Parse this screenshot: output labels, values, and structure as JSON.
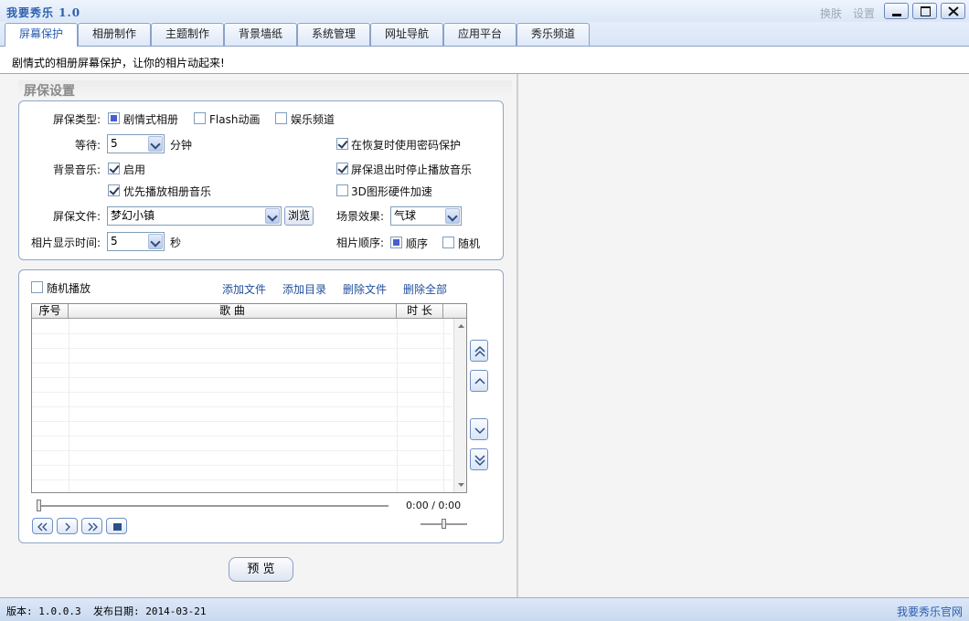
{
  "title_bar": {
    "app_title": "我要秀乐 1.0",
    "skin_link": "换肤",
    "settings_link": "设置"
  },
  "tabs": [
    {
      "label": "屏幕保护",
      "active": true
    },
    {
      "label": "相册制作"
    },
    {
      "label": "主题制作"
    },
    {
      "label": "背景墙纸"
    },
    {
      "label": "系统管理"
    },
    {
      "label": "网址导航"
    },
    {
      "label": "应用平台"
    },
    {
      "label": "秀乐频道"
    }
  ],
  "description": "剧情式的相册屏幕保护，让你的相片动起来!",
  "section_title": "屏保设置",
  "settings": {
    "type_label": "屏保类型:",
    "type_options": [
      {
        "label": "剧情式相册",
        "checked": true
      },
      {
        "label": "Flash动画",
        "checked": false
      },
      {
        "label": "娱乐频道",
        "checked": false
      }
    ],
    "wait_label": "等待:",
    "wait_value": "5",
    "wait_unit": "分钟",
    "password_protect": {
      "label": "在恢复时使用密码保护",
      "checked": true
    },
    "bgm_label": "背景音乐:",
    "bgm_enable": {
      "label": "启用",
      "checked": true
    },
    "stop_music_on_exit": {
      "label": "屏保退出时停止播放音乐",
      "checked": true
    },
    "prefer_album_music": {
      "label": "优先播放相册音乐",
      "checked": true
    },
    "hw_accel": {
      "label": "3D图形硬件加速",
      "checked": false
    },
    "file_label": "屏保文件:",
    "file_value": "梦幻小镇",
    "browse_label": "浏览",
    "scene_label": "场景效果:",
    "scene_value": "气球",
    "photo_time_label": "相片显示时间:",
    "photo_time_value": "5",
    "photo_time_unit": "秒",
    "order_label": "相片顺序:",
    "order_options": [
      {
        "label": "顺序",
        "checked": true
      },
      {
        "label": "随机",
        "checked": false
      }
    ]
  },
  "playlist": {
    "shuffle": {
      "label": "随机播放",
      "checked": false
    },
    "actions": [
      "添加文件",
      "添加目录",
      "删除文件",
      "删除全部"
    ],
    "columns": [
      "序号",
      "歌 曲",
      "时 长"
    ],
    "rows": [],
    "time_display": "0:00 / 0:00",
    "progress": 0,
    "volume": 0.5
  },
  "preview_label": "预 览",
  "status_bar": {
    "version": "版本: 1.0.0.3",
    "release_date": "发布日期: 2014-03-21",
    "website": "我要秀乐官网"
  },
  "icons": [
    "minimize-icon",
    "maximize-icon",
    "close-icon",
    "move-top-icon",
    "move-up-icon",
    "move-down-icon",
    "move-bottom-icon",
    "previous-icon",
    "play-icon",
    "next-icon",
    "stop-icon"
  ],
  "colors": {
    "accent": "#2a5fb0",
    "border": "#90a6c8",
    "panel": "#f4f4f4"
  }
}
